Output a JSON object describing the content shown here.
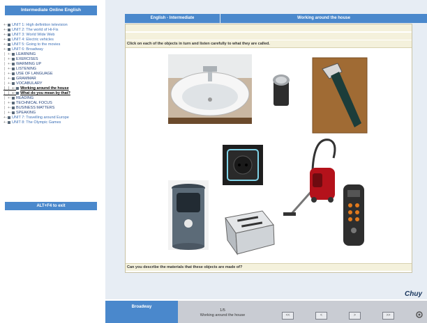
{
  "sidebar": {
    "title": "Intermediate Online English",
    "tree": [
      {
        "lines": "+-",
        "label": "UNIT 1: High definition television",
        "cls": ""
      },
      {
        "lines": "+-",
        "label": "UNIT 2: The world of Hi-Fis",
        "cls": ""
      },
      {
        "lines": "+-",
        "label": "UNIT 3: World Wide Web",
        "cls": ""
      },
      {
        "lines": "+-",
        "label": "UNIT 4: Electric vehicles",
        "cls": ""
      },
      {
        "lines": "+-",
        "label": "UNIT 5: Going to the movies",
        "cls": ""
      },
      {
        "lines": "+-",
        "label": "UNIT 6: Broadway",
        "cls": ""
      },
      {
        "lines": "| +-",
        "label": "LEARNING",
        "cls": "sub"
      },
      {
        "lines": "| +-",
        "label": "EXERCISES",
        "cls": "sub"
      },
      {
        "lines": "|   +-",
        "label": "WARMING UP",
        "cls": "sub"
      },
      {
        "lines": "|   +-",
        "label": "LISTENING",
        "cls": "sub"
      },
      {
        "lines": "|   +-",
        "label": "USE OF LANGUAGE",
        "cls": "sub"
      },
      {
        "lines": "|   +-",
        "label": "GRAMMAR",
        "cls": "sub"
      },
      {
        "lines": "|   +-",
        "label": "VOCABULARY",
        "cls": "sub"
      },
      {
        "lines": "|   | +-",
        "label": "Working around the house",
        "cls": "cur"
      },
      {
        "lines": "|   | +-",
        "label": "What do you mean by that?",
        "cls": "cur"
      },
      {
        "lines": "|   +-",
        "label": "READING",
        "cls": "sub"
      },
      {
        "lines": "|   +-",
        "label": "TECHNICAL FOCUS",
        "cls": "sub"
      },
      {
        "lines": "|   +-",
        "label": "BUSINESS MATTERS",
        "cls": "sub"
      },
      {
        "lines": "|   +-",
        "label": "SPEAKING",
        "cls": "sub"
      },
      {
        "lines": "+-",
        "label": "UNIT 7: Travelling around Europe",
        "cls": ""
      },
      {
        "lines": "+-",
        "label": "UNIT 8: The Olympic Games",
        "cls": ""
      }
    ],
    "exit_label": "ALT+F4 to exit"
  },
  "header": {
    "course": "English - Intermediate",
    "lesson": "Working around the house"
  },
  "content": {
    "instruction": "Click on each of the objects in turn and listen carefully to what they are called.",
    "question": "Can you describe the materials that these objects are made of?"
  },
  "footer": {
    "section": "Broadway",
    "page": "1/5",
    "lesson": "Working around the house",
    "nav": [
      "<<",
      "<",
      ">",
      ">>"
    ]
  },
  "brand": "Chuy"
}
